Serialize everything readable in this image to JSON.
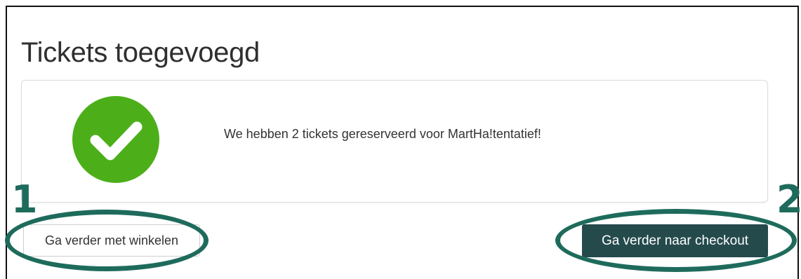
{
  "page": {
    "title": "Tickets toegevoegd"
  },
  "confirmation": {
    "icon": "check-circle-icon",
    "icon_color": "#4caf1a",
    "message": "We hebben 2 tickets gereserveerd voor MartHa!tentatief!"
  },
  "actions": {
    "continue_shopping_label": "Ga verder met winkelen",
    "checkout_label": "Ga verder naar checkout",
    "checkout_color": "#244a4c"
  },
  "annotations": {
    "color": "#1e6b5c",
    "marker_1": "1",
    "marker_2": "2"
  }
}
